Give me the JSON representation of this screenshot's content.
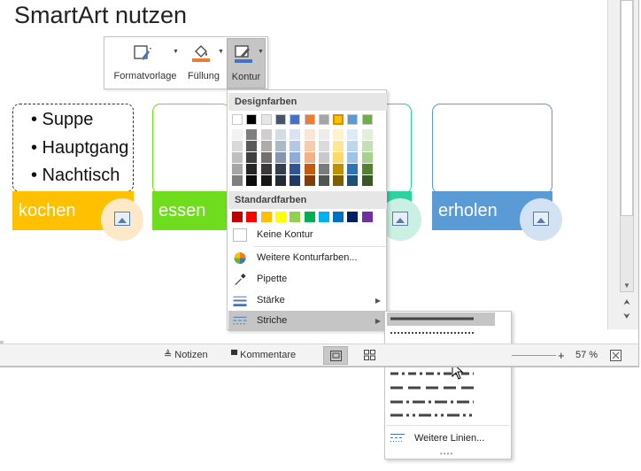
{
  "slide": {
    "title": "SmartArt nutzen",
    "bullets": [
      "• Suppe",
      "• Hauptgang",
      "• Nachtisch"
    ],
    "shapes": [
      {
        "label": "kochen",
        "color": "#ffc000",
        "pic_bg": "#fde9c8"
      },
      {
        "label": "essen",
        "color": "#6fdc1e",
        "pic_bg": "#dcf5c6"
      },
      {
        "label": "",
        "color": "#2ed1a0",
        "pic_bg": "#c9f0e3"
      },
      {
        "label": "erholen",
        "color": "#5b9bd5",
        "pic_bg": "#d3e2f2"
      }
    ]
  },
  "mini_toolbar": {
    "format_label": "Formatvorlage",
    "fill_label": "Füllung",
    "outline_label": "Kontur",
    "fill_color": "#ed7d31",
    "outline_color": "#4472c4"
  },
  "outline_menu": {
    "theme_colors_header": "Designfarben",
    "standard_colors_header": "Standardfarben",
    "theme_colors": [
      [
        "#ffffff",
        "#f2f2f2",
        "#d9d9d9",
        "#bfbfbf",
        "#a6a6a6",
        "#808080"
      ],
      [
        "#000000",
        "#7f7f7f",
        "#595959",
        "#3f3f3f",
        "#262626",
        "#0c0c0c"
      ],
      [
        "#e7e6e6",
        "#d0cece",
        "#aeabab",
        "#757070",
        "#3a3838",
        "#171616"
      ],
      [
        "#44546a",
        "#d6dce4",
        "#acb9ca",
        "#8496b0",
        "#333f4f",
        "#222a35"
      ],
      [
        "#4472c4",
        "#dae3f3",
        "#b4c7e7",
        "#8faadc",
        "#2f5597",
        "#203864"
      ],
      [
        "#ed7d31",
        "#fbe5d6",
        "#f8cbad",
        "#f4b183",
        "#c55a11",
        "#843c0c"
      ],
      [
        "#a5a5a5",
        "#ededed",
        "#dbdbdb",
        "#c9c9c9",
        "#7b7b7b",
        "#525252"
      ],
      [
        "#ffc000",
        "#fff2cc",
        "#ffe699",
        "#ffd966",
        "#bf9000",
        "#7f6000"
      ],
      [
        "#5b9bd5",
        "#deebf7",
        "#bdd7ee",
        "#9dc3e6",
        "#2e75b6",
        "#1f4e79"
      ],
      [
        "#70ad47",
        "#e2f0d9",
        "#c5e0b4",
        "#a9d18e",
        "#548235",
        "#385723"
      ]
    ],
    "standard_colors": [
      "#c00000",
      "#ff0000",
      "#ffc000",
      "#ffff00",
      "#92d050",
      "#00b050",
      "#00b0f0",
      "#0070c0",
      "#002060",
      "#7030a0"
    ],
    "items": {
      "no_outline": "Keine Kontur",
      "more_colors": "Weitere Konturfarben...",
      "eyedropper": "Pipette",
      "weight": "Stärke",
      "dashes": "Striche"
    }
  },
  "dashes_menu": {
    "more_lines": "Weitere Linien...",
    "styles": [
      "solid",
      "round-dot",
      "square-dot",
      "dash",
      "dash-dot",
      "long-dash",
      "long-dash-dot",
      "long-dash-dot-dot"
    ],
    "selected_index": 3
  },
  "statusbar": {
    "notes": "Notizen",
    "comments": "Kommentare",
    "zoom": "57 %"
  }
}
